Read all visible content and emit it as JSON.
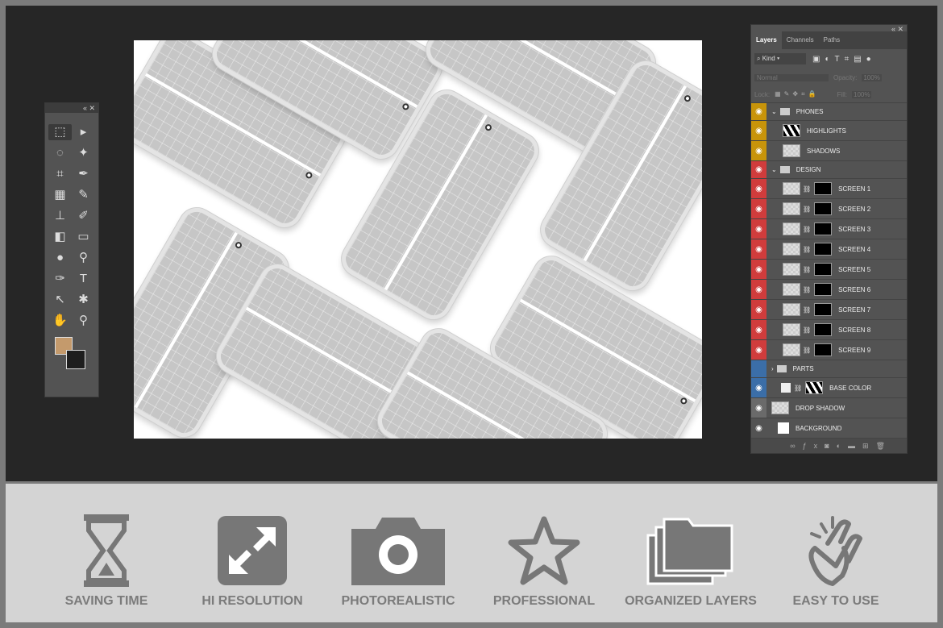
{
  "toolbox": {
    "collapse": "«  ✕"
  },
  "layers_panel": {
    "tabs": [
      "Layers",
      "Channels",
      "Paths"
    ],
    "filter": "Kind",
    "blend_mode": "Normal",
    "opacity_label": "Opacity:",
    "opacity": "100%",
    "lock_label": "Lock:",
    "fill_label": "Fill:",
    "fill": "100%",
    "layers": [
      {
        "name": "PHONES",
        "type": "group",
        "color": "#c8940a",
        "indent": 0,
        "expanded": true
      },
      {
        "name": "HIGHLIGHTS",
        "type": "layer",
        "color": "#c8940a",
        "indent": 1
      },
      {
        "name": "SHADOWS",
        "type": "layer",
        "color": "#c8940a",
        "indent": 1
      },
      {
        "name": "DESIGN",
        "type": "group",
        "color": "#d03c3c",
        "indent": 0,
        "expanded": true
      },
      {
        "name": "SCREEN 1",
        "type": "smart",
        "color": "#d03c3c",
        "indent": 1
      },
      {
        "name": "SCREEN 2",
        "type": "smart",
        "color": "#d03c3c",
        "indent": 1
      },
      {
        "name": "SCREEN 3",
        "type": "smart",
        "color": "#d03c3c",
        "indent": 1
      },
      {
        "name": "SCREEN 4",
        "type": "smart",
        "color": "#d03c3c",
        "indent": 1
      },
      {
        "name": "SCREEN 5",
        "type": "smart",
        "color": "#d03c3c",
        "indent": 1
      },
      {
        "name": "SCREEN 6",
        "type": "smart",
        "color": "#d03c3c",
        "indent": 1
      },
      {
        "name": "SCREEN 7",
        "type": "smart",
        "color": "#d03c3c",
        "indent": 1
      },
      {
        "name": "SCREEN 8",
        "type": "smart",
        "color": "#d03c3c",
        "indent": 1
      },
      {
        "name": "SCREEN 9",
        "type": "smart",
        "color": "#d03c3c",
        "indent": 1
      },
      {
        "name": "PARTS",
        "type": "group",
        "color": "#3b6ea8",
        "indent": 0,
        "expanded": false,
        "hidden": true
      },
      {
        "name": "BASE COLOR",
        "type": "fill",
        "color": "#3b6ea8",
        "indent": 1
      },
      {
        "name": "DROP SHADOW",
        "type": "layer",
        "color": "#6a6a6a",
        "indent": 0
      },
      {
        "name": "BACKGROUND",
        "type": "bg",
        "color": "#535353",
        "indent": 0
      }
    ]
  },
  "colors": {
    "foreground": "#c49a6c",
    "background": "#1e1e1e"
  },
  "features": [
    {
      "label": "SAVING TIME",
      "icon": "hourglass-icon"
    },
    {
      "label": "HI RESOLUTION",
      "icon": "expand-icon"
    },
    {
      "label": "PHOTOREALISTIC",
      "icon": "camera-icon"
    },
    {
      "label": "PROFESSIONAL",
      "icon": "star-icon"
    },
    {
      "label": "ORGANIZED LAYERS",
      "icon": "folders-icon"
    },
    {
      "label": "EASY TO USE",
      "icon": "tap-hand-icon"
    }
  ]
}
